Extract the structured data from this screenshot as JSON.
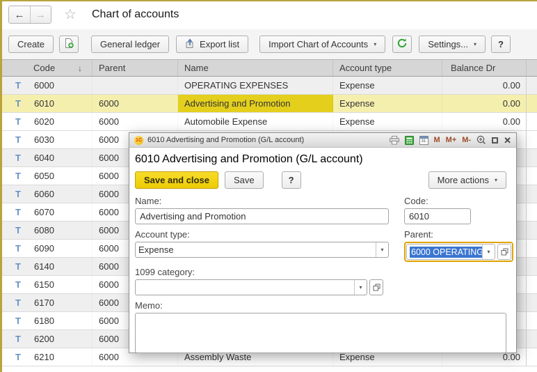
{
  "header": {
    "title": "Chart of accounts"
  },
  "icons": {
    "back": "←",
    "forward": "→",
    "star": "☆",
    "sort_desc": "↓",
    "dropdown": "▾",
    "calendar_day": "31",
    "logo": "1C",
    "t_account": "T",
    "maximize": "",
    "close": "✕"
  },
  "toolbar": {
    "create": "Create",
    "general_ledger": "General ledger",
    "export_list": "Export list",
    "import_coa": "Import Chart of Accounts",
    "settings": "Settings...",
    "help": "?"
  },
  "table": {
    "columns": {
      "code": "Code",
      "parent": "Parent",
      "name": "Name",
      "account_type": "Account type",
      "balance_dr": "Balance Dr"
    },
    "rows": [
      {
        "code": "6000",
        "parent": "",
        "name": "OPERATING EXPENSES",
        "type": "Expense",
        "balance": "0.00"
      },
      {
        "code": "6010",
        "parent": "6000",
        "name": "Advertising and Promotion",
        "type": "Expense",
        "balance": "0.00"
      },
      {
        "code": "6020",
        "parent": "6000",
        "name": "Automobile Expense",
        "type": "Expense",
        "balance": "0.00"
      },
      {
        "code": "6030",
        "parent": "6000",
        "name": "",
        "type": "",
        "balance": ""
      },
      {
        "code": "6040",
        "parent": "6000",
        "name": "",
        "type": "",
        "balance": ""
      },
      {
        "code": "6050",
        "parent": "6000",
        "name": "",
        "type": "",
        "balance": ""
      },
      {
        "code": "6060",
        "parent": "6000",
        "name": "",
        "type": "",
        "balance": ""
      },
      {
        "code": "6070",
        "parent": "6000",
        "name": "",
        "type": "",
        "balance": ""
      },
      {
        "code": "6080",
        "parent": "6000",
        "name": "",
        "type": "",
        "balance": ""
      },
      {
        "code": "6090",
        "parent": "6000",
        "name": "",
        "type": "",
        "balance": ""
      },
      {
        "code": "6140",
        "parent": "6000",
        "name": "",
        "type": "",
        "balance": ""
      },
      {
        "code": "6150",
        "parent": "6000",
        "name": "",
        "type": "",
        "balance": ""
      },
      {
        "code": "6170",
        "parent": "6000",
        "name": "",
        "type": "",
        "balance": ""
      },
      {
        "code": "6180",
        "parent": "6000",
        "name": "",
        "type": "",
        "balance": ""
      },
      {
        "code": "6200",
        "parent": "6000",
        "name": "",
        "type": "",
        "balance": ""
      },
      {
        "code": "6210",
        "parent": "6000",
        "name": "Assembly Waste",
        "type": "Expense",
        "balance": "0.00"
      }
    ]
  },
  "dialog": {
    "titlebar": {
      "title": "6010 Advertising and Promotion (G/L account)",
      "memory": [
        "M",
        "M+",
        "M-"
      ]
    },
    "heading": "6010 Advertising and Promotion (G/L account)",
    "buttons": {
      "save_close": "Save and close",
      "save": "Save",
      "help": "?",
      "more_actions": "More actions"
    },
    "fields": {
      "name": {
        "label": "Name:",
        "value": "Advertising and Promotion"
      },
      "code": {
        "label": "Code:",
        "value": "6010"
      },
      "account_type": {
        "label": "Account type:",
        "value": "Expense"
      },
      "parent": {
        "label": "Parent:",
        "value": "6000 OPERATING"
      },
      "category_1099": {
        "label": "1099 category:",
        "value": ""
      },
      "memo": {
        "label": "Memo:",
        "value": ""
      }
    },
    "colors": {
      "accent_yellow": "#eecb05",
      "focus_ring": "#dfa300",
      "selection_blue": "#3b76d0"
    }
  }
}
